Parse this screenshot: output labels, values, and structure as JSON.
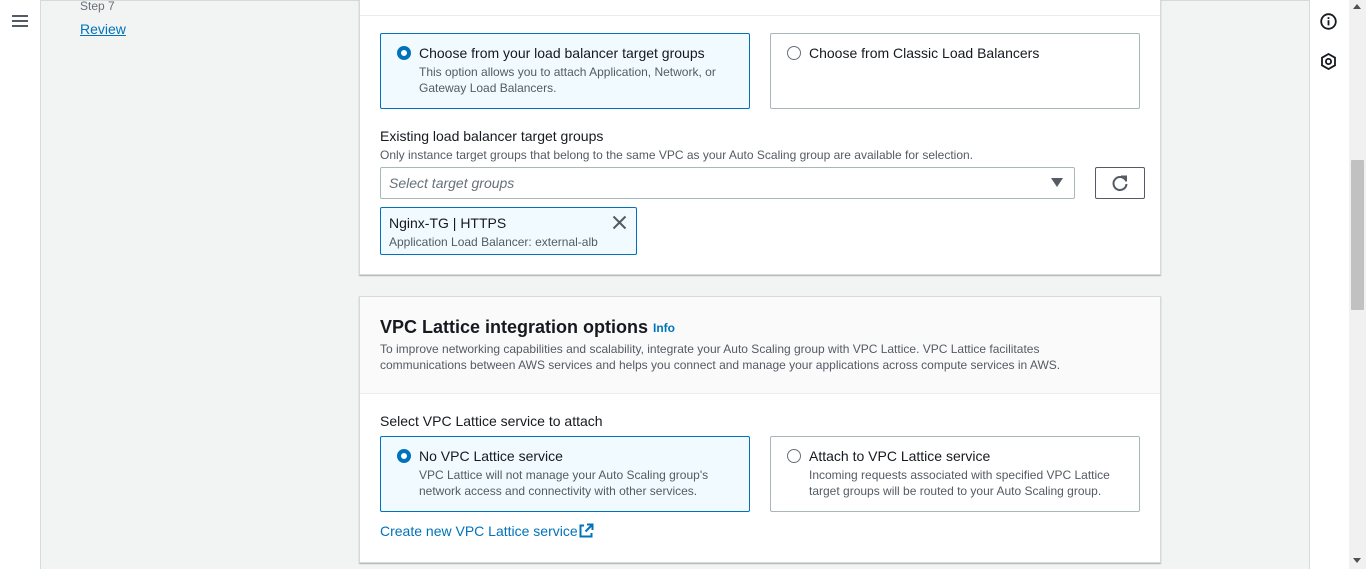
{
  "wizard_nav": {
    "step_label": "Step 7",
    "review_label": "Review"
  },
  "load_balancer": {
    "options": [
      {
        "title": "Choose from your load balancer target groups",
        "description": "This option allows you to attach Application, Network, or Gateway Load Balancers.",
        "selected": true
      },
      {
        "title": "Choose from Classic Load Balancers",
        "description": "",
        "selected": false
      }
    ],
    "existing_label": "Existing load balancer target groups",
    "existing_description": "Only instance target groups that belong to the same VPC as your Auto Scaling group are available for selection.",
    "select_placeholder": "Select target groups",
    "selected_token": {
      "title": "Nginx-TG | HTTPS",
      "description": "Application Load Balancer: external-alb"
    }
  },
  "vpc_lattice": {
    "title": "VPC Lattice integration options",
    "info_label": "Info",
    "description": "To improve networking capabilities and scalability, integrate your Auto Scaling group with VPC Lattice. VPC Lattice facilitates communications between AWS services and helps you connect and manage your applications across compute services in AWS.",
    "select_label": "Select VPC Lattice service to attach",
    "options": [
      {
        "title": "No VPC Lattice service",
        "description": "VPC Lattice will not manage your Auto Scaling group's network access and connectivity with other services.",
        "selected": true
      },
      {
        "title": "Attach to VPC Lattice service",
        "description": "Incoming requests associated with specified VPC Lattice target groups will be routed to your Auto Scaling group.",
        "selected": false
      }
    ],
    "create_link": "Create new VPC Lattice service"
  },
  "icons": {
    "menu": "hamburger-menu-icon",
    "info": "info-circle-icon",
    "cube": "cube-hexagon-icon",
    "caret": "caret-down-icon",
    "refresh": "refresh-icon",
    "close": "close-icon",
    "external": "external-link-icon"
  },
  "colors": {
    "accent": "#0073bb",
    "selected_bg": "#f1faff",
    "text": "#16191f",
    "secondary_text": "#545b64",
    "border": "#aab7b8",
    "page_bg": "#f2f3f3"
  }
}
